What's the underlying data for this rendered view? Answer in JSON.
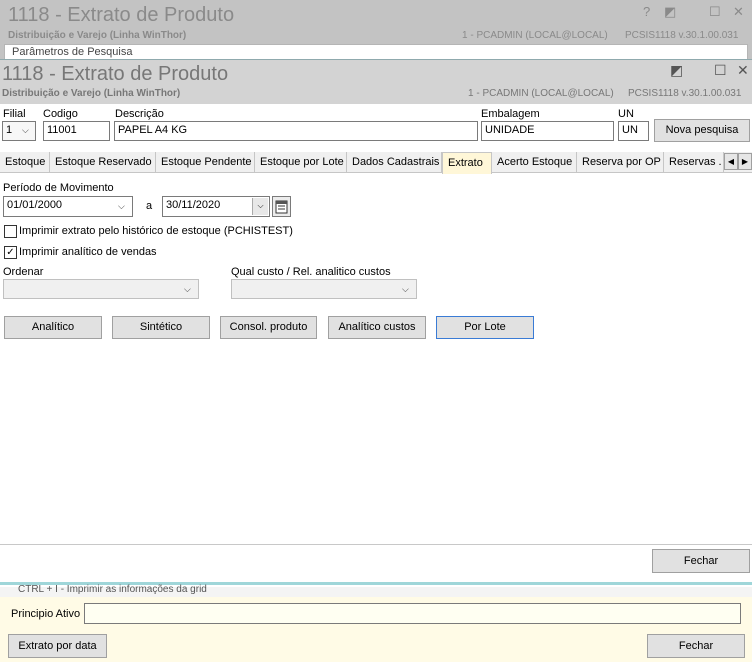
{
  "background_window": {
    "title": "1118 - Extrato de Produto",
    "subtitle": "Distribuição e Varejo (Linha WinThor)",
    "user": "1 - PCADMIN (LOCAL@LOCAL)",
    "version": "PCSIS1118  v.30.1.00.031",
    "panel_label": "Parâmetros de Pesquisa",
    "help_icon": "?",
    "restore_icon": "◩",
    "maximize_icon": "☐",
    "close_icon": "✕"
  },
  "window": {
    "title": "1118 - Extrato de Produto",
    "subtitle": "Distribuição e Varejo (Linha WinThor)",
    "user": "1 - PCADMIN (LOCAL@LOCAL)",
    "version": "PCSIS1118  v.30.1.00.031",
    "restore_icon": "◩",
    "maximize_icon": "☐",
    "close_icon": "✕"
  },
  "header": {
    "filial_label": "Filial",
    "filial_value": "1",
    "codigo_label": "Codigo",
    "codigo_value": "11001",
    "descricao_label": "Descrição",
    "descricao_value": "PAPEL A4 KG",
    "embalagem_label": "Embalagem",
    "embalagem_value": "UNIDADE",
    "un_label": "UN",
    "un_value": "UN",
    "nova_pesquisa": "Nova pesquisa"
  },
  "tabs": [
    {
      "label": "Estoque",
      "active": false
    },
    {
      "label": "Estoque Reservado",
      "active": false
    },
    {
      "label": "Estoque Pendente",
      "active": false
    },
    {
      "label": "Estoque por Lote",
      "active": false
    },
    {
      "label": "Dados Cadastrais",
      "active": false
    },
    {
      "label": "Extrato",
      "active": true
    },
    {
      "label": "Acerto Estoque",
      "active": false
    },
    {
      "label": "Reserva por OP",
      "active": false
    },
    {
      "label": "Reservas .",
      "active": false
    }
  ],
  "tab_scroll": {
    "left": "◀",
    "right": "▶"
  },
  "extrato": {
    "periodo_label": "Período de Movimento",
    "data_inicio": "01/01/2000",
    "separador": "a",
    "data_fim": "30/11/2020",
    "calendar_icon": "calendar-icon",
    "chk_historico_label": "Imprimir extrato pelo histórico de estoque (PCHISTEST)",
    "chk_historico_checked": false,
    "chk_analitico_label": "Imprimir analítico de vendas",
    "chk_analitico_checked": true,
    "check_mark": "✓",
    "ordenar_label": "Ordenar",
    "qual_custo_label": "Qual custo / Rel. analitico custos",
    "dropdown_arrow": "⌵",
    "buttons": {
      "analitico": "Analítico",
      "sintetico": "Sintético",
      "consol_produto": "Consol. produto",
      "analitico_custos": "Analítico custos",
      "por_lote": "Por Lote"
    }
  },
  "footer": {
    "fechar": "Fechar"
  },
  "bottom": {
    "strip_text": "CTRL + I - Imprimir as informações da grid",
    "principio_label": "Principio Ativo",
    "principio_value": "",
    "extrato_por_data": "Extrato por data",
    "fechar": "Fechar"
  },
  "colors": {
    "active_tab": "#fff7d8",
    "focus_border": "#3a7bd5",
    "title_bar": "#d3d3d3",
    "bottom_panel": "#fffbe6"
  }
}
